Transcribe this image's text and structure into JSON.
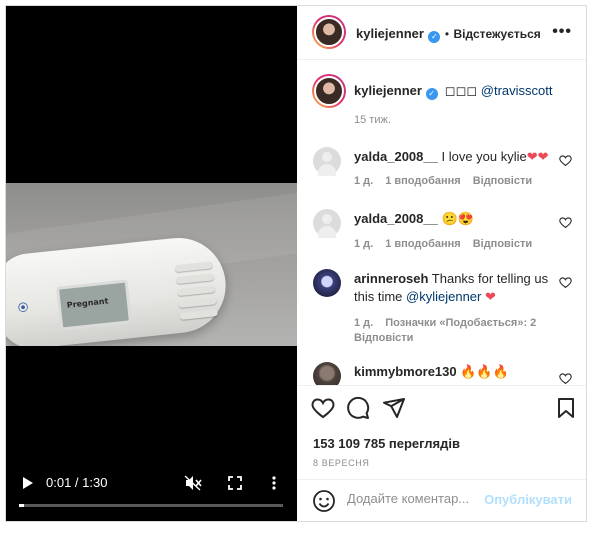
{
  "video": {
    "time": "0:01 / 1:30",
    "progress_percent": 2,
    "test_window_text": "Pregnant"
  },
  "header": {
    "username": "kyliejenner",
    "separator": "•",
    "follow_label": "Відстежується",
    "more_icon": "more-dots-icon"
  },
  "caption": {
    "username": "kyliejenner",
    "text": " ◻◻◻ ",
    "mention": "@travisscott",
    "time": "15 тиж."
  },
  "comments": [
    {
      "username": "yalda_2008__",
      "text": " I love you kylie",
      "emoji": "❤❤",
      "time": "1 д.",
      "likes": "1 вподобання",
      "reply": "Відповісти"
    },
    {
      "username": "yalda_2008__",
      "text": " 😕😍",
      "emoji": "",
      "time": "1 д.",
      "likes": "1 вподобання",
      "reply": "Відповісти"
    },
    {
      "username": "arinneroseh",
      "text": " Thanks for telling us this time ",
      "mention": "@kyliejenner",
      "emoji": "❤",
      "time": "1 д.",
      "likes": "Позначки «Подобається»: 2",
      "reply": "Відповісти"
    },
    {
      "username": "kimmybmore130",
      "text": " 🔥🔥🔥",
      "emoji": ""
    }
  ],
  "stats": {
    "views": "153 109 785 переглядів",
    "date": "8 ВЕРЕСНЯ"
  },
  "add_comment": {
    "placeholder": "Додайте коментар...",
    "publish_label": "Опублікувати"
  },
  "colors": {
    "verified": "#3897f0",
    "publish_disabled": "#b2dffc",
    "heart": "#ed4956"
  }
}
